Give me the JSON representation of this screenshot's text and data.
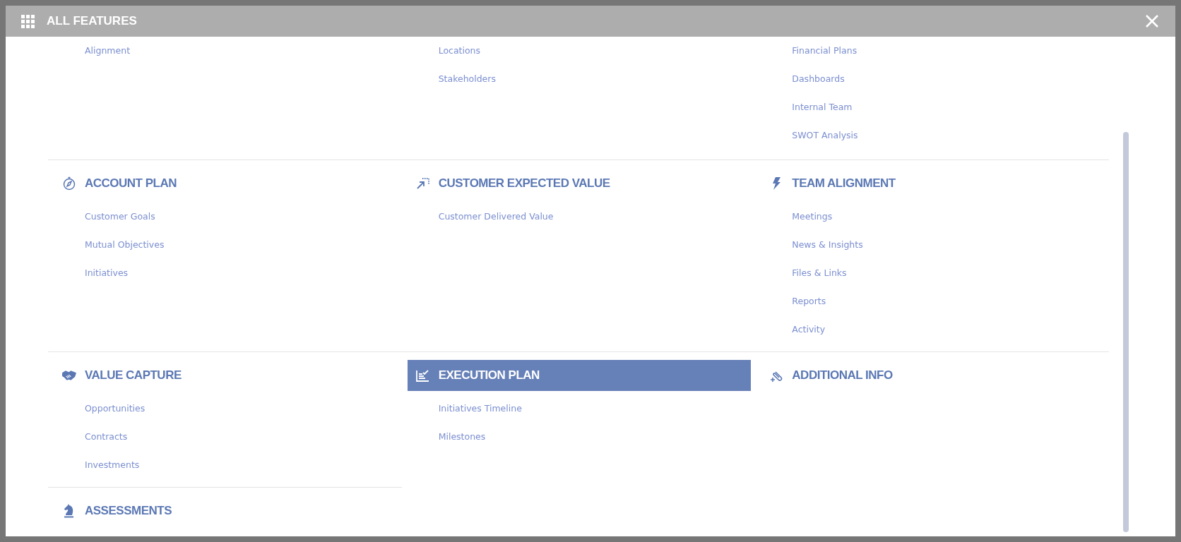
{
  "window": {
    "title": "ALL FEATURES"
  },
  "rows": [
    {
      "sections": [
        {
          "items": [
            "Alignment"
          ]
        },
        {
          "items": [
            "Locations",
            "Stakeholders"
          ]
        },
        {
          "items": [
            "Financial Plans",
            "Dashboards",
            "Internal Team",
            "SWOT Analysis"
          ]
        }
      ]
    },
    {
      "sections": [
        {
          "title": "ACCOUNT PLAN",
          "selected": false,
          "items": [
            "Customer Goals",
            "Mutual Objectives",
            "Initiatives"
          ]
        },
        {
          "title": "CUSTOMER EXPECTED VALUE",
          "selected": false,
          "items": [
            "Customer Delivered Value"
          ]
        },
        {
          "title": "TEAM ALIGNMENT",
          "selected": false,
          "items": [
            "Meetings",
            "News & Insights",
            "Files & Links",
            "Reports",
            "Activity"
          ]
        }
      ]
    },
    {
      "sections": [
        {
          "title": "VALUE CAPTURE",
          "selected": false,
          "items": [
            "Opportunities",
            "Contracts",
            "Investments"
          ]
        },
        {
          "title": "EXECUTION PLAN",
          "selected": true,
          "items": [
            "Initiatives Timeline",
            "Milestones"
          ]
        },
        {
          "title": "ADDITIONAL INFO",
          "selected": false
        }
      ]
    },
    {
      "sections": [
        {
          "title": "ASSESSMENTS",
          "selected": false
        }
      ]
    }
  ]
}
